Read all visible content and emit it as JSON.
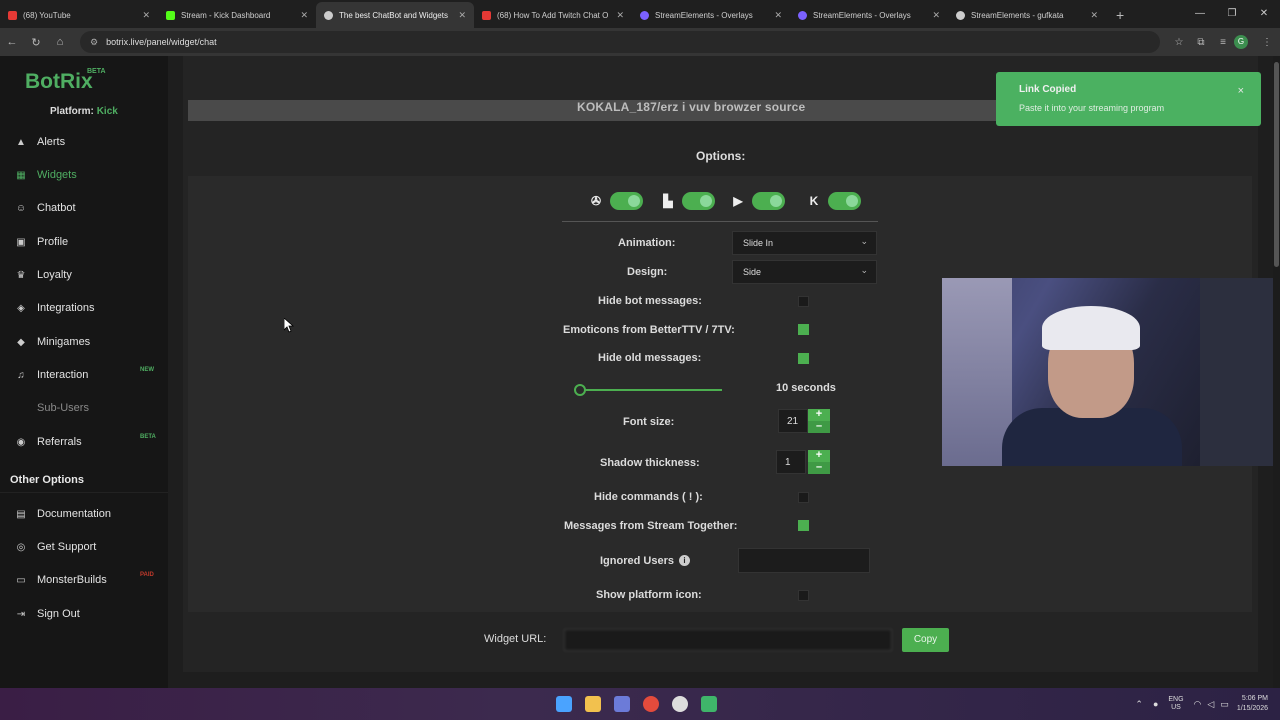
{
  "browser": {
    "tabs": [
      {
        "label": "(68) YouTube",
        "color": "#e53935"
      },
      {
        "label": "Stream - Kick Dashboard",
        "color": "#53fc18"
      },
      {
        "label": "The best ChatBot and Widgets",
        "color": "#cccccc",
        "active": true
      },
      {
        "label": "(68) How To Add Twitch Chat O",
        "color": "#e53935"
      },
      {
        "label": "StreamElements - Overlays",
        "color": "#7b61ff"
      },
      {
        "label": "StreamElements - Overlays",
        "color": "#7b61ff"
      },
      {
        "label": "StreamElements - gufkata",
        "color": "#cccccc"
      }
    ],
    "new_tab": "+",
    "url": "botrix.live/panel/widget/chat"
  },
  "sidebar": {
    "logo": "BotRix",
    "logo_badge": "BETA",
    "platform_label": "Platform:",
    "platform_value": "Kick",
    "items": [
      {
        "label": "Alerts",
        "icon": "warning-icon"
      },
      {
        "label": "Widgets",
        "icon": "widgets-icon",
        "active": true
      },
      {
        "label": "Chatbot",
        "icon": "robot-icon"
      },
      {
        "label": "Profile",
        "icon": "profile-icon"
      },
      {
        "label": "Loyalty",
        "icon": "trophy-icon"
      },
      {
        "label": "Integrations",
        "icon": "integrations-icon"
      },
      {
        "label": "Minigames",
        "icon": "gamepad-icon"
      },
      {
        "label": "Interaction",
        "icon": "music-icon",
        "badge": "NEW"
      },
      {
        "label": "Sub-Users",
        "icon": "users-icon",
        "muted": true
      },
      {
        "label": "Referrals",
        "icon": "referrals-icon",
        "badge": "BETA"
      }
    ],
    "other_heading": "Other Options",
    "other_items": [
      {
        "label": "Documentation",
        "icon": "book-icon"
      },
      {
        "label": "Get Support",
        "icon": "help-icon"
      },
      {
        "label": "MonsterBuilds",
        "icon": "monitor-icon",
        "badge": "PAID"
      },
      {
        "label": "Sign Out",
        "icon": "sign-out-icon"
      }
    ]
  },
  "main": {
    "top_strip_text": "KOKALA_187/erz i vuv browzer source",
    "options_title": "Options:",
    "platforms": [
      "kick-alt-icon",
      "twitch-icon",
      "youtube-icon",
      "kick-icon"
    ],
    "animation_label": "Animation:",
    "animation_value": "Slide In",
    "design_label": "Design:",
    "design_value": "Side",
    "hide_bot_label": "Hide bot messages:",
    "hide_bot": false,
    "emoticons_label": "Emoticons from BetterTTV / 7TV:",
    "emoticons": true,
    "hide_old_label": "Hide old messages:",
    "hide_old": true,
    "hide_old_seconds": "10 seconds",
    "hide_old_slider_fraction": 0.05,
    "font_size_label": "Font size:",
    "font_size": "21",
    "shadow_label": "Shadow thickness:",
    "shadow": "1",
    "hide_commands_label": "Hide commands ( ! ):",
    "hide_commands": false,
    "stream_together_label": "Messages from Stream Together:",
    "stream_together": true,
    "ignored_label": "Ignored Users",
    "show_platform_label": "Show platform icon:",
    "show_platform": false,
    "widget_url_label": "Widget URL:",
    "copy_label": "Copy"
  },
  "toast": {
    "title": "Link Copied",
    "message": "Paste it into your streaming program",
    "close": "×"
  },
  "taskbar": {
    "lang_top": "ENG",
    "lang_bottom": "US",
    "time": "5:06 PM",
    "date": "1/15/2026"
  },
  "colors": {
    "accent": "#4caf50",
    "sidebar_bg": "#161616",
    "toast_bg": "#4bb161"
  }
}
